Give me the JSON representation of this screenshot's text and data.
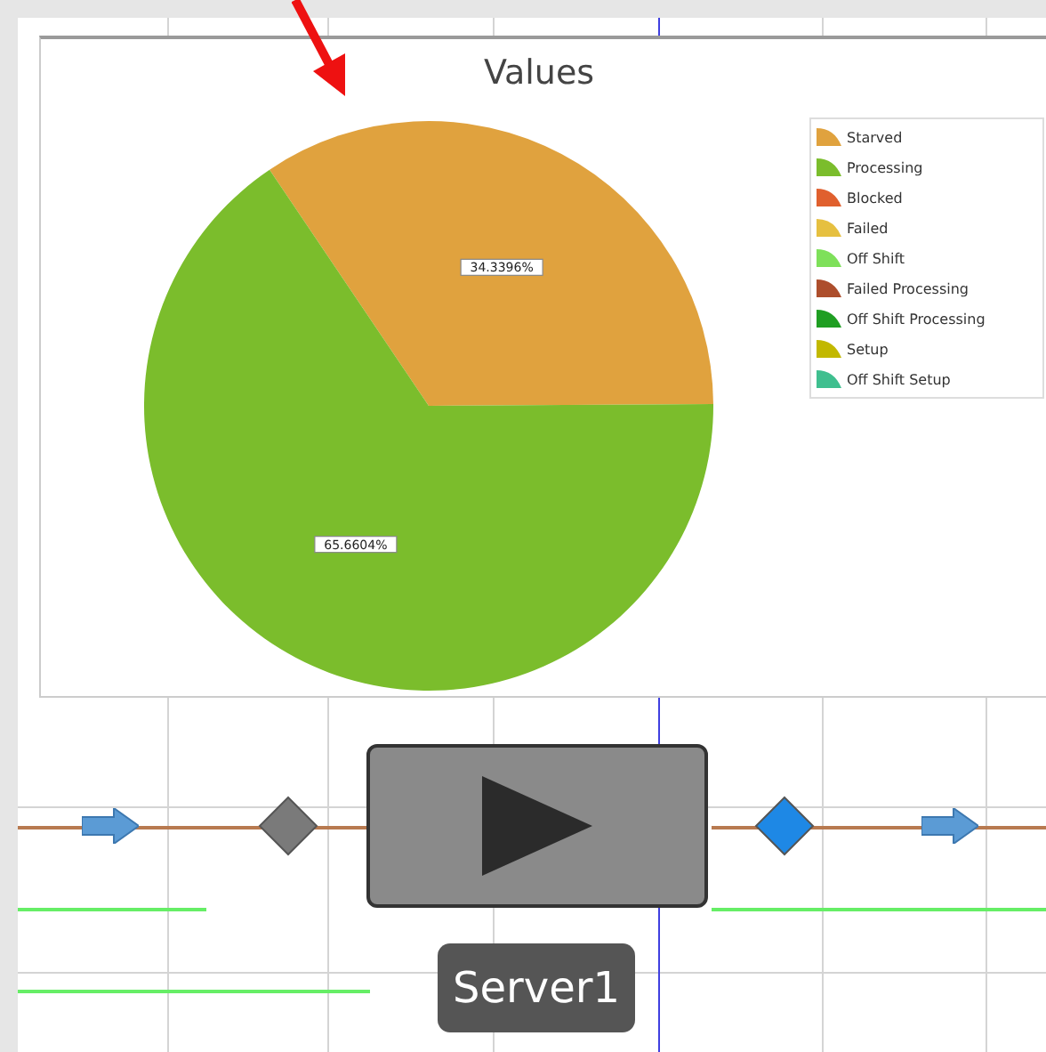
{
  "chart_panel": {
    "chart_data": {
      "type": "pie",
      "title": "Values",
      "data_labels": true,
      "legend": "right",
      "categories": [
        "Starved",
        "Processing",
        "Blocked",
        "Failed",
        "Off Shift",
        "Failed Processing",
        "Off Shift Processing",
        "Setup",
        "Off Shift Setup"
      ],
      "values": [
        34.3396,
        65.6604,
        0,
        0,
        0,
        0,
        0,
        0,
        0
      ],
      "colors": [
        "#e0a23e",
        "#7bbd2c",
        "#e0602e",
        "#e6c040",
        "#7ee05a",
        "#ad4e2c",
        "#1f9e22",
        "#c2b800",
        "#3fbf8f"
      ],
      "value_labels": [
        "34.3396%",
        "65.6604%",
        null,
        null,
        null,
        null,
        null,
        null,
        null
      ]
    }
  },
  "server": {
    "label": "Server1"
  }
}
